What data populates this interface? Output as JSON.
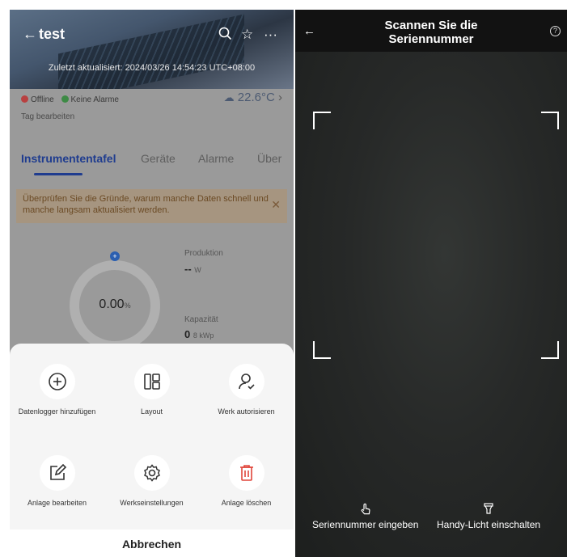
{
  "left": {
    "header": {
      "back_icon": "arrow-left-icon",
      "title": "test",
      "updated": "Zuletzt aktualisiert: 2024/03/26 14:54:23 UTC+08:00"
    },
    "status": {
      "offline": "Offline",
      "alarms": "Keine Alarme",
      "offline_color": "#d64545",
      "ok_color": "#3aa94a"
    },
    "weather": {
      "icon": "cloud-rain-icon",
      "temp": "22.6°C"
    },
    "tag": "Tag bearbeiten",
    "tabs": [
      {
        "label": "Instrumententafel",
        "active": true
      },
      {
        "label": "Geräte",
        "active": false
      },
      {
        "label": "Alarme",
        "active": false
      },
      {
        "label": "Über",
        "active": false
      }
    ],
    "notice": "Überprüfen Sie die Gründe, warum manche Daten schnell und manche langsam aktualisiert werden.",
    "gauge": {
      "value": "0.00",
      "unit": "%"
    },
    "production": {
      "label": "Produktion",
      "value": "--",
      "unit": "W"
    },
    "capacity": {
      "label": "Kapazität",
      "value": "0",
      "unit": "8 kWp"
    },
    "sheet": {
      "actions": [
        {
          "label": "Datenlogger hinzufügen",
          "icon": "plus-circle-icon"
        },
        {
          "label": "Layout",
          "icon": "layout-grid-icon"
        },
        {
          "label": "Werk autorisieren",
          "icon": "user-check-icon"
        },
        {
          "label": "Anlage bearbeiten",
          "icon": "edit-icon"
        },
        {
          "label": "Werkseinstellungen",
          "icon": "gear-icon"
        },
        {
          "label": "Anlage löschen",
          "icon": "trash-icon"
        }
      ],
      "cancel": "Abbrechen",
      "delete_color": "#e0453a"
    }
  },
  "right": {
    "header": {
      "title": "Scannen Sie die Seriennummer"
    },
    "actions": [
      {
        "label": "Seriennummer eingeben",
        "icon": "hand-pointer-icon"
      },
      {
        "label": "Handy-Licht einschalten",
        "icon": "flashlight-icon"
      }
    ]
  }
}
